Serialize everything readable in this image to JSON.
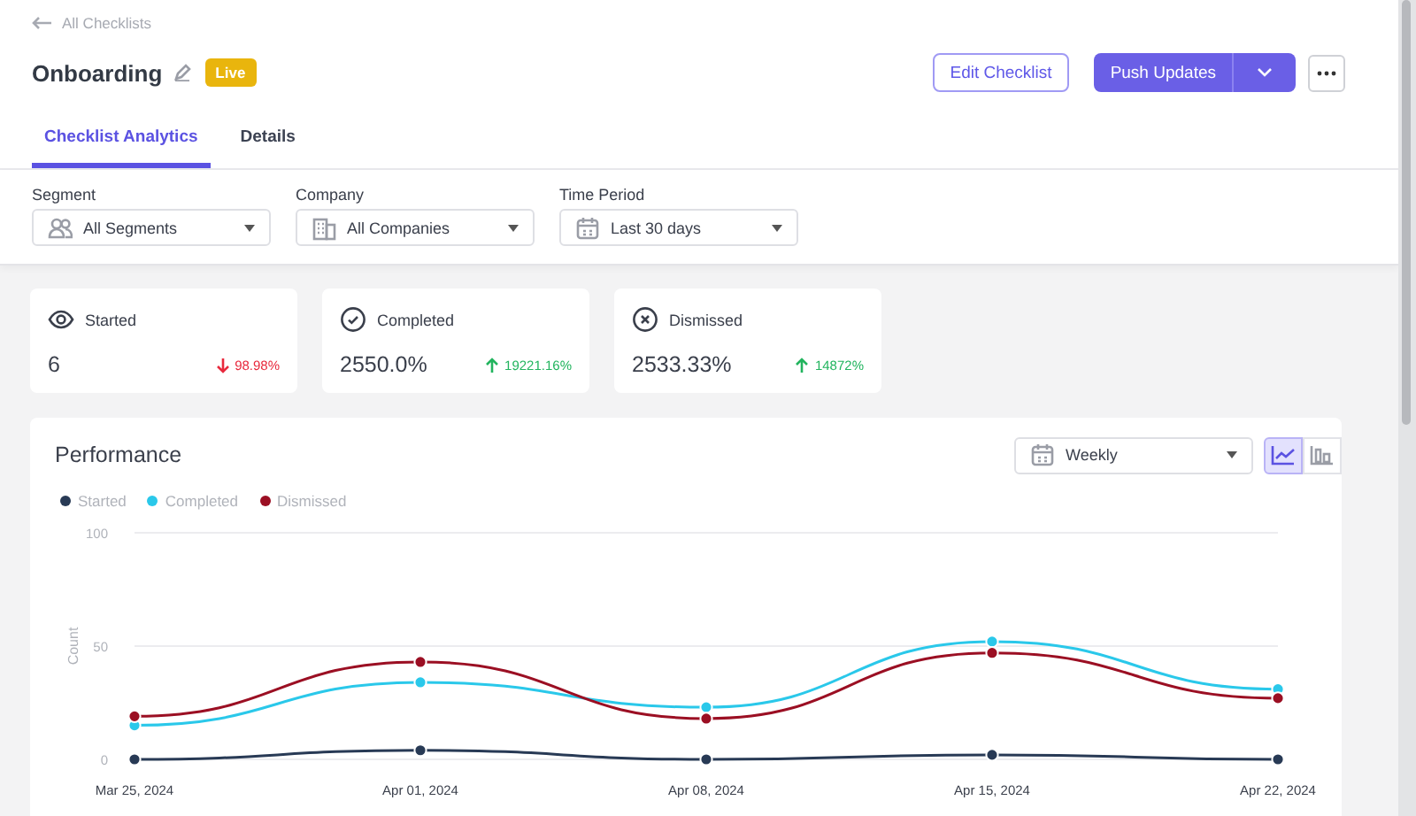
{
  "back_link": "All Checklists",
  "title": "Onboarding",
  "status_badge": "Live",
  "actions": {
    "edit": "Edit Checklist",
    "push": "Push Updates"
  },
  "tabs": [
    {
      "label": "Checklist Analytics",
      "selected": true
    },
    {
      "label": "Details",
      "selected": false
    }
  ],
  "filters": [
    {
      "label": "Segment",
      "value": "All Segments",
      "kind": "segment"
    },
    {
      "label": "Company",
      "value": "All Companies",
      "kind": "company"
    },
    {
      "label": "Time Period",
      "value": "Last 30 days",
      "kind": "calendar"
    }
  ],
  "stats": [
    {
      "kind": "started",
      "label": "Started",
      "value": "6",
      "change": "98.98%",
      "increase": false
    },
    {
      "kind": "completed",
      "label": "Completed",
      "value": "2550.0%",
      "change": "19221.16%",
      "increase": true
    },
    {
      "kind": "dismissed",
      "label": "Dismissed",
      "value": "2533.33%",
      "change": "14872%",
      "increase": true
    }
  ],
  "performance": {
    "title": "Performance",
    "interval": "Weekly",
    "views": [
      {
        "kind": "line",
        "selected": true
      },
      {
        "kind": "bar",
        "selected": false
      }
    ],
    "chart_data": {
      "type": "line",
      "ylabel": "Count",
      "categories": [
        "Mar 25, 2024",
        "Apr 01, 2024",
        "Apr 08, 2024",
        "Apr 15, 2024",
        "Apr 22, 2024"
      ],
      "ylim": [
        0,
        100
      ],
      "yticks": [
        0,
        50,
        100
      ],
      "series": [
        {
          "name": "Started",
          "color": "#283a55",
          "marker": "circle",
          "values": [
            0,
            4,
            0,
            2,
            0
          ]
        },
        {
          "name": "Completed",
          "color": "#2ac8ea",
          "marker": "circle",
          "values": [
            15,
            34,
            23,
            52,
            31
          ]
        },
        {
          "name": "Dismissed",
          "color": "#9b0f23",
          "marker": "circle",
          "values": [
            19,
            43,
            18,
            47,
            27
          ]
        }
      ]
    }
  }
}
